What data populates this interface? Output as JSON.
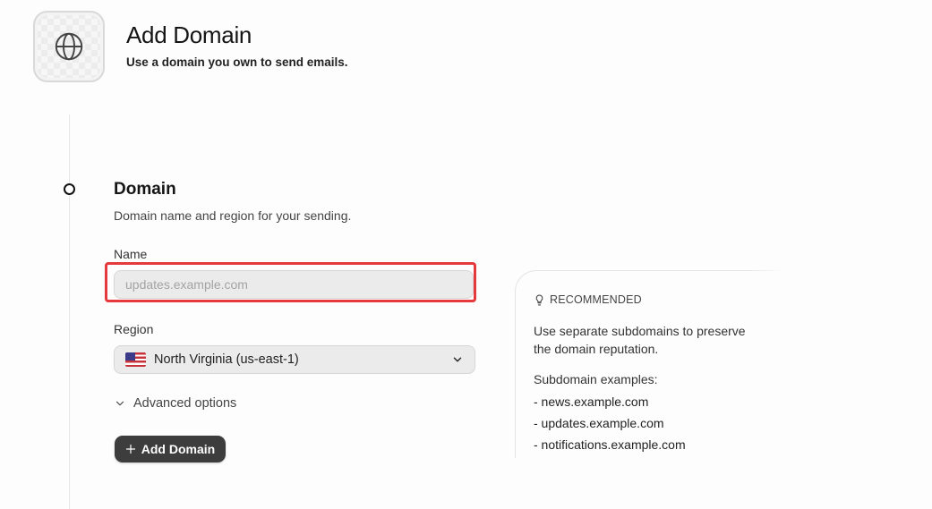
{
  "header": {
    "title": "Add Domain",
    "subtitle": "Use a domain you own to send emails.",
    "icon": "globe-icon"
  },
  "section": {
    "title": "Domain",
    "description": "Domain name and region for your sending."
  },
  "form": {
    "name_label": "Name",
    "name_placeholder": "updates.example.com",
    "name_value": "",
    "region_label": "Region",
    "region_value": "North Virginia (us-east-1)",
    "region_flag": "us-flag-icon",
    "advanced_label": "Advanced options",
    "submit_label": "Add Domain"
  },
  "recommendation": {
    "heading": "RECOMMENDED",
    "text": "Use separate subdomains to preserve the domain reputation.",
    "examples_title": "Subdomain examples:",
    "examples": [
      "- news.example.com",
      "- updates.example.com",
      "- notifications.example.com"
    ]
  },
  "colors": {
    "highlight": "#e5393d",
    "button_bg": "#3d3d3d",
    "input_bg": "#ebebeb"
  }
}
